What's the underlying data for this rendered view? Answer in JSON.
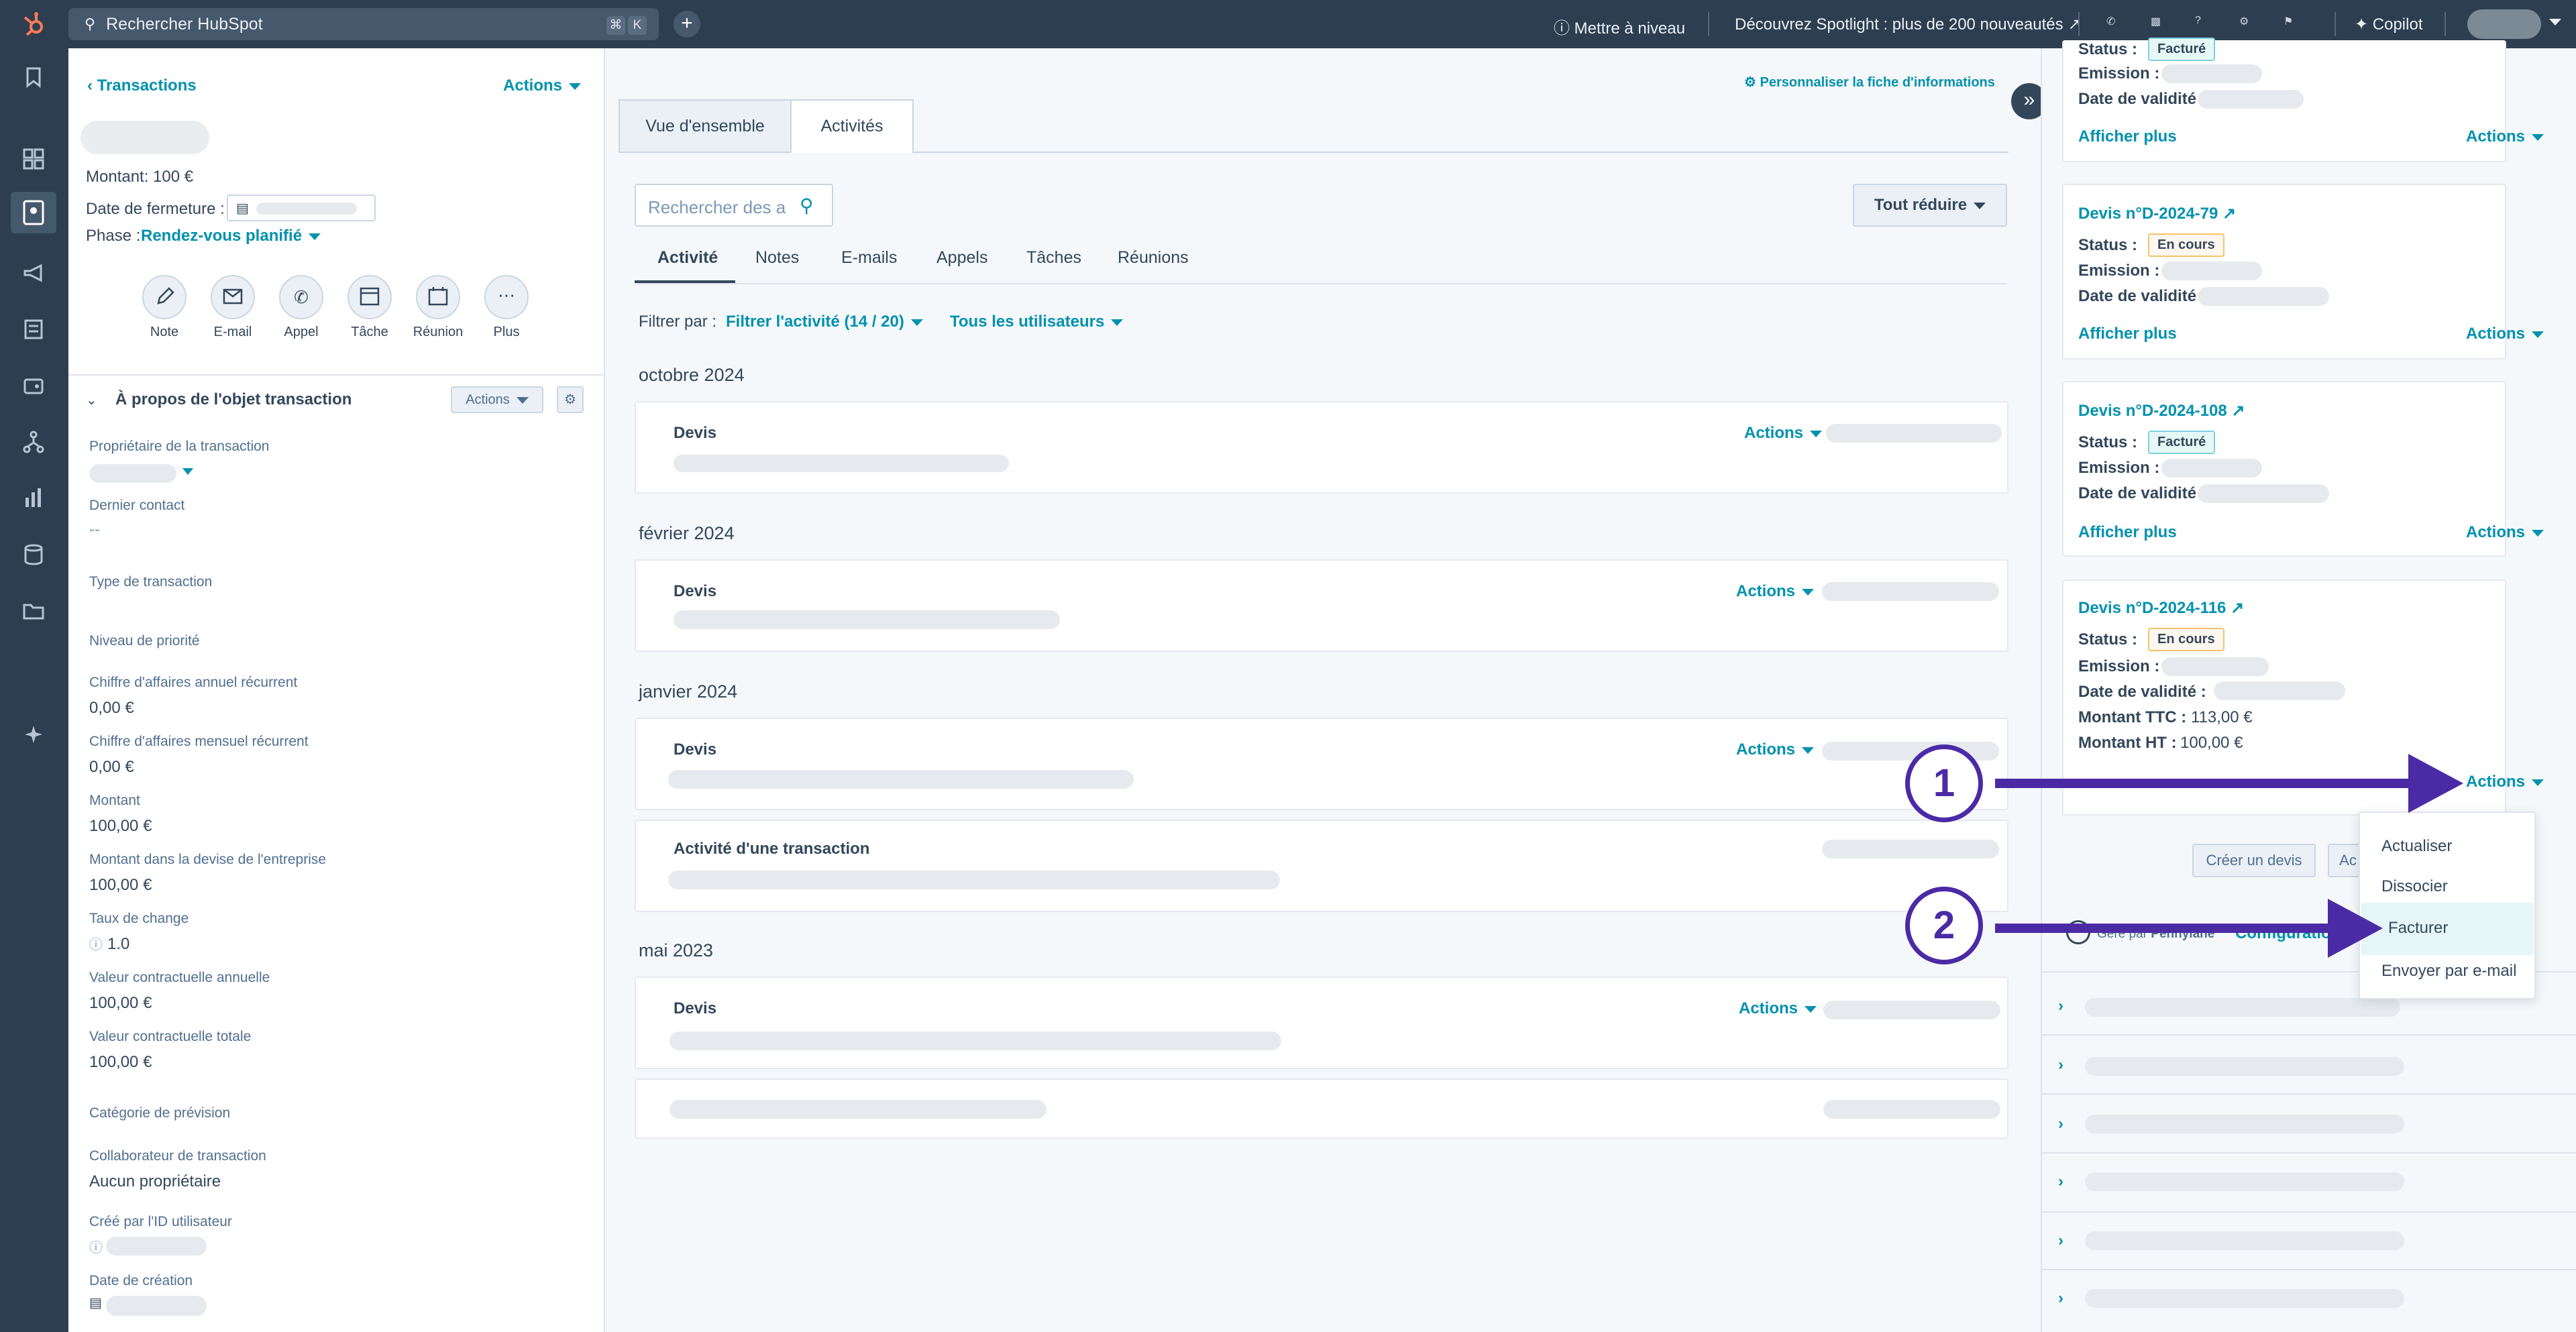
{
  "topbar": {
    "search_placeholder": "Rechercher HubSpot",
    "kbd1": "⌘",
    "kbd2": "K",
    "upgrade": "Mettre à niveau",
    "spotlight": "Découvrez Spotlight : plus de 200 nouveautés",
    "copilot": "Copilot"
  },
  "left": {
    "breadcrumb": "Transactions",
    "actions": "Actions",
    "amount_line": "Montant: 100 €",
    "close_date_label": "Date de fermeture :",
    "phase_label": "Phase :",
    "phase_value": "Rendez-vous planifié",
    "quick_actions": [
      "Note",
      "E-mail",
      "Appel",
      "Tâche",
      "Réunion",
      "Plus"
    ],
    "about_title": "À propos de l'objet transaction",
    "about_actions": "Actions",
    "fields": [
      {
        "label": "Propriétaire de la transaction",
        "value": ""
      },
      {
        "label": "Dernier contact",
        "value": "--"
      },
      {
        "label": "Type de transaction",
        "value": ""
      },
      {
        "label": "Niveau de priorité",
        "value": ""
      },
      {
        "label": "Chiffre d'affaires annuel récurrent",
        "value": "0,00 €"
      },
      {
        "label": "Chiffre d'affaires mensuel récurrent",
        "value": "0,00 €"
      },
      {
        "label": "Montant",
        "value": "100,00 €"
      },
      {
        "label": "Montant dans la devise de l'entreprise",
        "value": "100,00 €"
      },
      {
        "label": "Taux de change",
        "value": "1.0"
      },
      {
        "label": "Valeur contractuelle annuelle",
        "value": "100,00 €"
      },
      {
        "label": "Valeur contractuelle totale",
        "value": "100,00 €"
      },
      {
        "label": "Catégorie de prévision",
        "value": ""
      },
      {
        "label": "Collaborateur de transaction",
        "value": "Aucun propriétaire"
      },
      {
        "label": "Créé par l'ID utilisateur",
        "value": ""
      },
      {
        "label": "Date de création",
        "value": ""
      }
    ]
  },
  "middle": {
    "personalize": "Personnaliser la fiche d'informations",
    "tabs": [
      "Vue d'ensemble",
      "Activités"
    ],
    "search_placeholder": "Rechercher des a",
    "collapse_all": "Tout réduire",
    "subtabs": [
      "Activité",
      "Notes",
      "E-mails",
      "Appels",
      "Tâches",
      "Réunions"
    ],
    "filter_label": "Filtrer par :",
    "filter_activity": "Filtrer l'activité (14 / 20)",
    "filter_users": "Tous les utilisateurs",
    "months": [
      "octobre 2024",
      "février 2024",
      "janvier 2024",
      "mai 2023"
    ],
    "card_devis": "Devis",
    "card_actions": "Actions",
    "card_transaction_activity": "Activité d'une transaction"
  },
  "right": {
    "top_card": {
      "status_label": "Status :",
      "status_value": "Facturé",
      "emission_label": "Emission :",
      "validity_label": "Date de validité :",
      "show_more": "Afficher plus",
      "actions": "Actions"
    },
    "cards": [
      {
        "title": "Devis n°D-2024-79",
        "status_label": "Status :",
        "status": "En cours",
        "emission_label": "Emission :",
        "validity_label": "Date de validité :",
        "show_more": "Afficher plus",
        "actions": "Actions"
      },
      {
        "title": "Devis n°D-2024-108",
        "status_label": "Status :",
        "status": "Facturé",
        "emission_label": "Emission :",
        "validity_label": "Date de validité :",
        "show_more": "Afficher plus",
        "actions": "Actions"
      },
      {
        "title": "Devis n°D-2024-116",
        "status_label": "Status :",
        "status": "En cours",
        "emission_label": "Emission :",
        "validity_label": "Date de validité :",
        "ttc_label": "Montant TTC :",
        "ttc": "113,00 €",
        "ht_label": "Montant HT :",
        "ht": "100,00 €",
        "actions": "Actions"
      }
    ],
    "create_quote": "Créer un devis",
    "partial_button": "Ac",
    "managed_by": "Géré par",
    "pennylane": "Pennylane",
    "configure": "Configuratio",
    "menu": [
      "Actualiser",
      "Dissocier",
      "Facturer",
      "Envoyer par e-mail"
    ]
  },
  "annotations": {
    "step1": "1",
    "step2": "2"
  },
  "colors": {
    "accent": "#0091ae",
    "nav": "#2d3e50",
    "arrow": "#4b2aa6"
  }
}
